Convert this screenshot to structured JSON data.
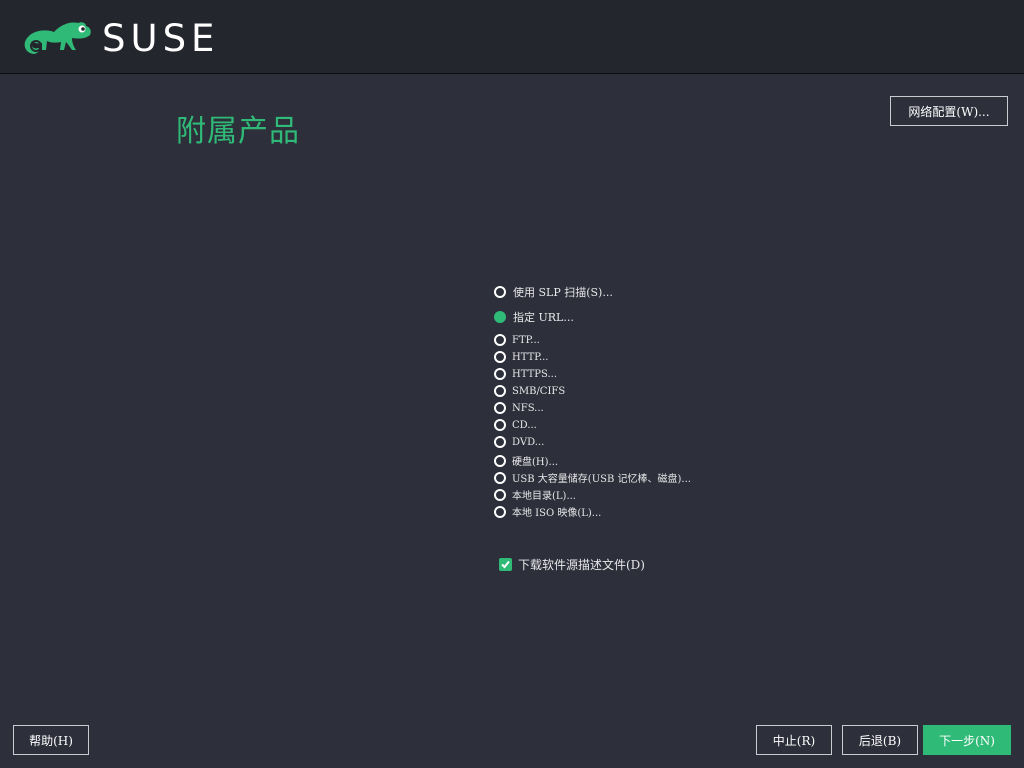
{
  "header": {
    "logo_text": "SUSE",
    "brand_color": "#30ba78"
  },
  "page": {
    "title": "附属产品"
  },
  "buttons": {
    "network_config": "网络配置(W)...",
    "help": "帮助(H)",
    "abort": "中止(R)",
    "back": "后退(B)",
    "next": "下一步(N)"
  },
  "options": {
    "slp_scan": "使用 SLP 扫描(S)...",
    "specify_url": "指定 URL...",
    "ftp": "FTP...",
    "http": "HTTP...",
    "https": "HTTPS...",
    "smb": "SMB/CIFS",
    "nfs": "NFS...",
    "cd": "CD...",
    "dvd": "DVD...",
    "hard_disk": "硬盘(H)...",
    "usb": "USB 大容量储存(USB 记忆棒、磁盘)...",
    "local_dir": "本地目录(L)...",
    "local_iso": "本地 ISO 映像(L)...",
    "selected": "specify_url"
  },
  "download_checkbox": {
    "label": "下载软件源描述文件(D)",
    "checked": true
  }
}
